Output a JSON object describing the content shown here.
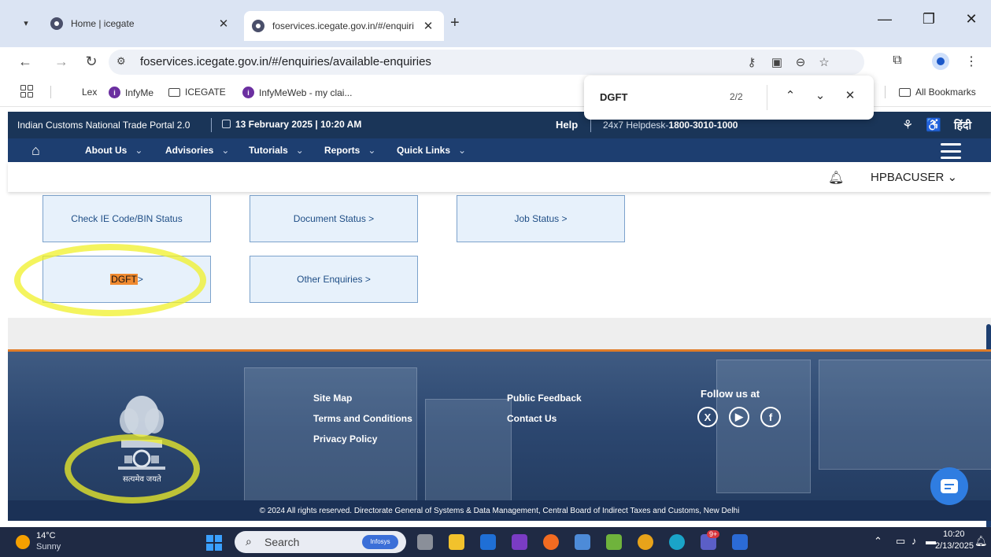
{
  "browser": {
    "tabs": [
      {
        "title": "Home | icegate",
        "active": false
      },
      {
        "title": "foservices.icegate.gov.in/#/enquiri",
        "active": true
      }
    ],
    "new_tab": "+",
    "tab_close": "✕",
    "url": "foservices.icegate.gov.in/#/enquiries/available-enquiries",
    "window_controls": {
      "minimize": "—",
      "restore": "❐",
      "close": "✕"
    }
  },
  "bookmarks": {
    "items": [
      {
        "label": "Lex",
        "icon": "none"
      },
      {
        "label": "InfyMe",
        "icon": "infy-icon"
      },
      {
        "label": "ICEGATE",
        "icon": "folder-icon"
      },
      {
        "label": "InfyMeWeb - my clai...",
        "icon": "infy-icon"
      }
    ],
    "all_bookmarks": "All Bookmarks"
  },
  "find_bar": {
    "query": "DGFT",
    "count": "2/2"
  },
  "portal": {
    "name": "Indian Customs National Trade Portal 2.0",
    "date": "13 February 2025 | 10:20 AM",
    "help": "Help",
    "helpdesk_prefix": "24x7 Helpdesk-",
    "helpdesk_number": "1800-3010-1000",
    "hindi": "हिंदी"
  },
  "nav": {
    "items": [
      "About Us",
      "Advisories",
      "Tutorials",
      "Reports",
      "Quick Links"
    ]
  },
  "user": {
    "name": "HPBACUSER"
  },
  "enquiries": {
    "check_ie": "Check IE Code/BIN Status",
    "document_status": "Document Status >",
    "job_status": "Job Status >",
    "dgft_highlight": "DGFT",
    "dgft_suffix": " >",
    "other": "Other Enquiries >"
  },
  "footer": {
    "links_col1": [
      "Site Map",
      "Terms and Conditions",
      "Privacy Policy"
    ],
    "links_col2": [
      "Public Feedback",
      "Contact Us"
    ],
    "follow": "Follow us at",
    "emblem_text": "सत्यमेव जयते",
    "copyright": "© 2024 All rights reserved. Directorate General of Systems & Data Management, Central Board of Indirect Taxes and Customs, New Delhi"
  },
  "taskbar": {
    "temp": "14°C",
    "condition": "Sunny",
    "search": "Search",
    "search_pill": "Infosys",
    "badge": "9+",
    "time": "10:20",
    "date": "2/13/2025"
  },
  "colors": {
    "portal_bar": "#1a3558",
    "nav_bar": "#1d3e70",
    "card_bg": "#e7f1fb",
    "find_highlight": "#f08a30",
    "footer_accent": "#e07c28",
    "marker": "#f0f028"
  }
}
